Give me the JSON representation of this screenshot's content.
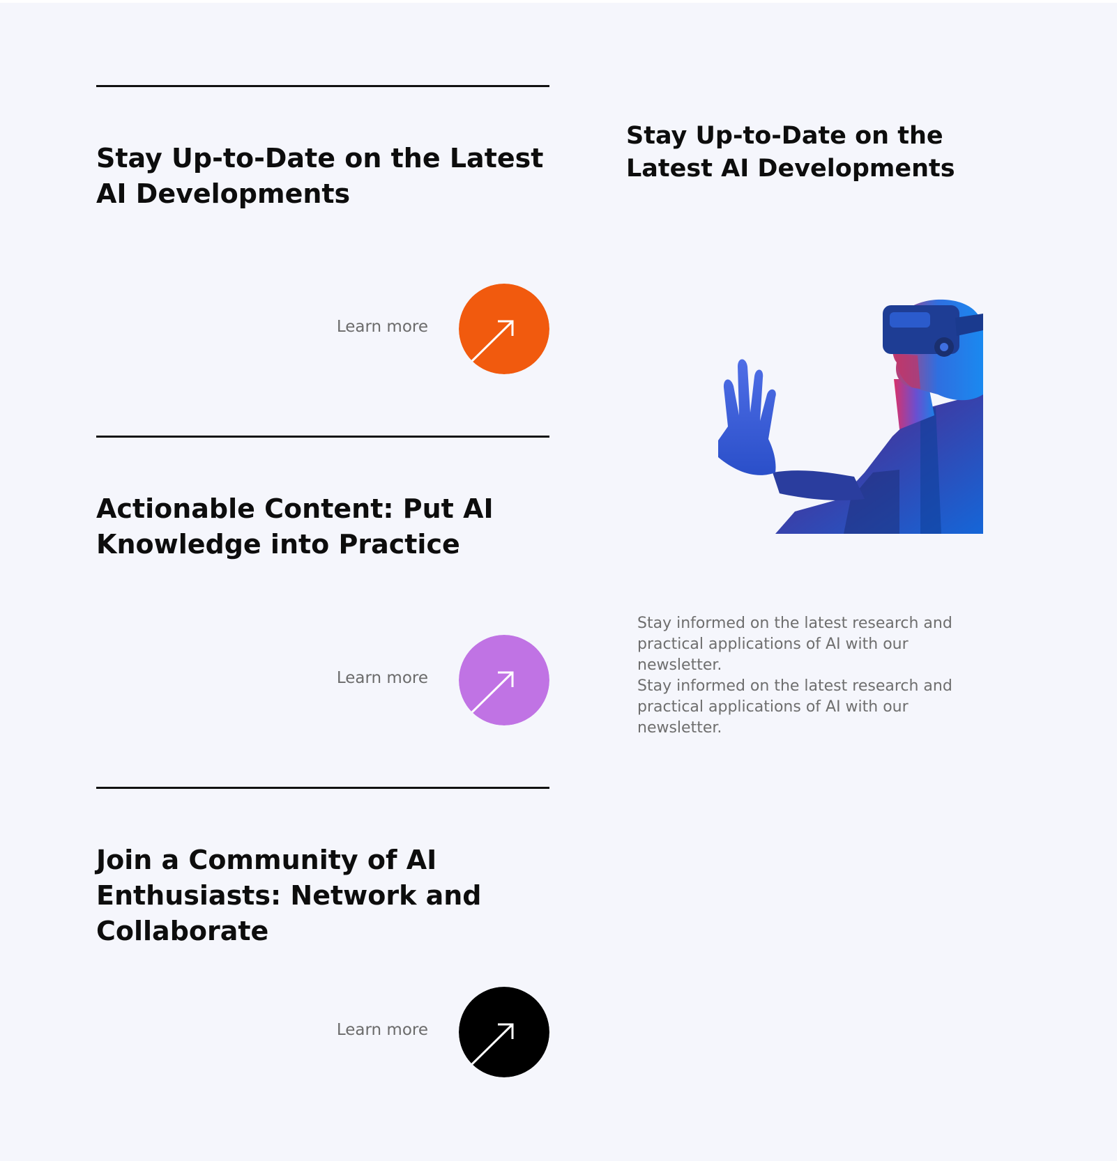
{
  "cards": [
    {
      "title": "Stay Up-to-Date on the Latest AI Developments",
      "cta_label": "Learn more",
      "accent": "#f15a0e"
    },
    {
      "title": "Actionable Content: Put AI Knowledge into Practice",
      "cta_label": "Learn more",
      "accent": "#c073e4"
    },
    {
      "title": "Join a Community of AI Enthusiasts: Network and Collaborate",
      "cta_label": "Learn more",
      "accent": "#000000"
    }
  ],
  "feature": {
    "title": "Stay Up-to-Date on the Latest AI Developments",
    "image_icon": "vr-headset-person-photo",
    "descriptions": [
      "Stay informed on the latest research and practical applications of AI with our newsletter.",
      "Stay informed on the latest research and practical applications of AI with our newsletter."
    ]
  },
  "icons": {
    "cta": "arrow-up-right-icon"
  },
  "colors": {
    "background": "#f5f6fc",
    "text": "#0d0d0d",
    "muted": "#6b6b6b"
  }
}
